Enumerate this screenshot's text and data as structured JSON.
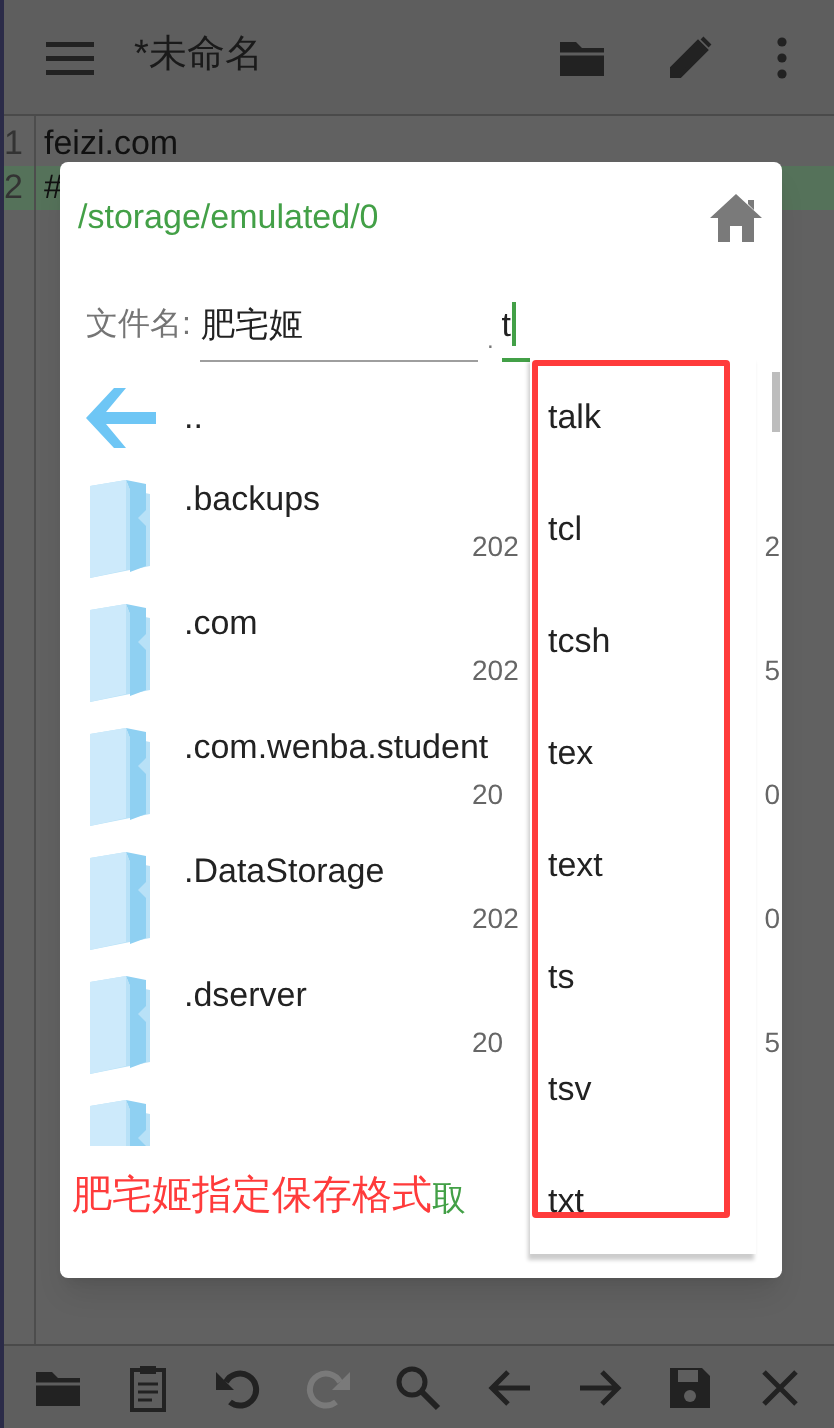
{
  "app_bar": {
    "title": "*未命名",
    "actions": [
      {
        "kind": "folder"
      },
      {
        "kind": "pencil"
      },
      {
        "kind": "more"
      }
    ]
  },
  "editor": {
    "lines": [
      {
        "number": "1",
        "text": "feizi.com",
        "current": false
      },
      {
        "number": "2",
        "text": "#",
        "current": true
      }
    ]
  },
  "dialog": {
    "path": "/storage/emulated/0",
    "filename_label": "文件名:",
    "filename": "肥宅姬",
    "dot": ".",
    "extension": "t",
    "items": [
      {
        "kind": "up",
        "name": ".."
      },
      {
        "kind": "folder",
        "name": ".backups",
        "date_start": "202",
        "date_end": "2"
      },
      {
        "kind": "folder",
        "name": ".com",
        "date_start": "202",
        "date_end": "5"
      },
      {
        "kind": "folder",
        "name": ".com.wenba.student",
        "date_start": "20",
        "date_end": "0"
      },
      {
        "kind": "folder",
        "name": ".DataStorage",
        "date_start": "202",
        "date_end": "0"
      },
      {
        "kind": "folder",
        "name": ".dserver",
        "date_start": "20",
        "date_end": "5"
      },
      {
        "kind": "folder-cut"
      }
    ],
    "caption": "肥宅姬指定保存格式",
    "cancel": "取"
  },
  "suggestions": [
    "talk",
    "tcl",
    "tcsh",
    "tex",
    "text",
    "ts",
    "tsv",
    "txt"
  ],
  "bottom_bar": [
    {
      "kind": "open",
      "disabled": false
    },
    {
      "kind": "paste",
      "disabled": false
    },
    {
      "kind": "undo",
      "disabled": false
    },
    {
      "kind": "redo",
      "disabled": true
    },
    {
      "kind": "search",
      "disabled": false
    },
    {
      "kind": "left",
      "disabled": false
    },
    {
      "kind": "right",
      "disabled": false
    },
    {
      "kind": "save",
      "disabled": false
    },
    {
      "kind": "close",
      "disabled": false
    }
  ]
}
